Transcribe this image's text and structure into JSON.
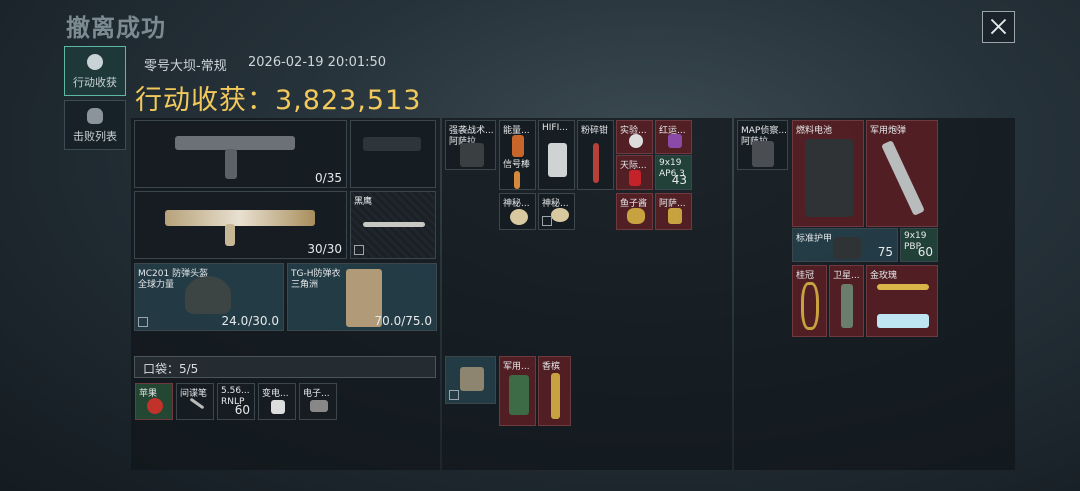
{
  "header": {
    "title": "撤离成功",
    "map": "零号大坝-常规",
    "datetime": "2026-02-19 20:01:50",
    "total_label": "行动收获：",
    "total_value": "3,823,513"
  },
  "tabs": [
    {
      "label": "行动收获",
      "icon": "coin-icon"
    },
    {
      "label": "击败列表",
      "icon": "skull-icon"
    }
  ],
  "equipment": {
    "primary1": {
      "count": "0/35"
    },
    "primary2": {
      "count": "30/30"
    },
    "melee": {
      "name": "黑鹰"
    },
    "helmet": {
      "name": "MC201 防弹头盔",
      "sub": "全球力量",
      "durability": "24.0/30.0"
    },
    "armor": {
      "name": "TG-H防弹衣",
      "sub": "三角洲",
      "durability": "70.0/75.0"
    }
  },
  "pocket": {
    "label": "口袋：5/5",
    "items": [
      {
        "name": "苹果"
      },
      {
        "name": "间谍笔"
      },
      {
        "name": "5.56...",
        "sub": "RNLP",
        "count": "60"
      },
      {
        "name": "变电..."
      },
      {
        "name": "电子..."
      }
    ]
  },
  "rig": {
    "name": "强袭战术...",
    "sub": "阿萨拉"
  },
  "rig_items": [
    {
      "name": "能量..."
    },
    {
      "name": "HIFI..."
    },
    {
      "name": "粉碎钳"
    },
    {
      "name": "实验..."
    },
    {
      "name": "红运..."
    },
    {
      "name": "信号棒"
    },
    {
      "name": "天际..."
    },
    {
      "name": "9x19",
      "sub": "AP6.3",
      "count": "43"
    },
    {
      "name": "神秘..."
    },
    {
      "name": "神秘..."
    },
    {
      "name": "鱼子酱"
    },
    {
      "name": "阿萨..."
    }
  ],
  "bag_items": [
    {
      "name": "军用..."
    },
    {
      "name": "香槟"
    }
  ],
  "backpack": {
    "name": "MAP侦察...",
    "sub": "阿萨拉"
  },
  "backpack_items": [
    {
      "name": "燃料电池"
    },
    {
      "name": "军用炮弹"
    },
    {
      "name": "标准护甲"
    },
    {
      "name": "9x19",
      "sub": "PBP",
      "count": "60",
      "count2": "75"
    },
    {
      "name": "桂冠"
    },
    {
      "name": "卫星..."
    },
    {
      "name": "金玫瑰"
    }
  ],
  "colors": {
    "accent": "#f2c95a",
    "rare_red": "#5c1e24",
    "tab_active": "#5fb7a8"
  }
}
